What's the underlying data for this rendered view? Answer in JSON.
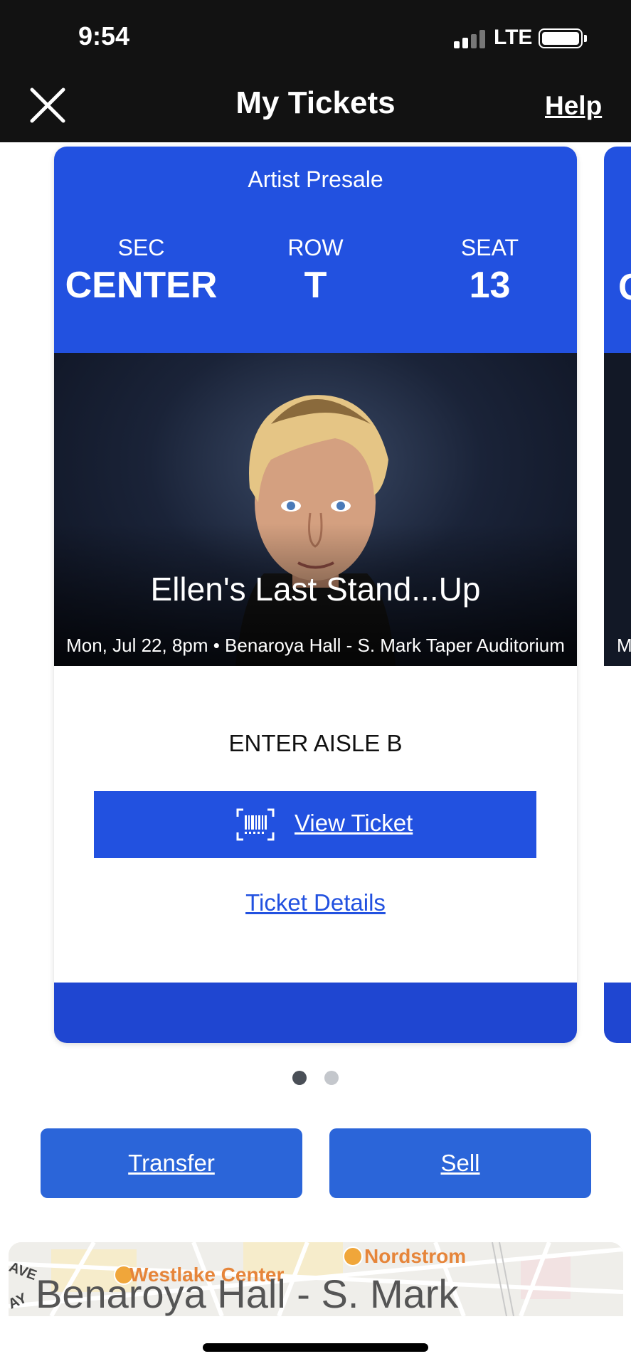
{
  "status_bar": {
    "time": "9:54",
    "network": "LTE"
  },
  "header": {
    "title": "My Tickets",
    "help_label": "Help"
  },
  "ticket": {
    "presale_label": "Artist Presale",
    "section": {
      "label": "SEC",
      "value": "CENTER"
    },
    "row": {
      "label": "ROW",
      "value": "T"
    },
    "seat": {
      "label": "SEAT",
      "value": "13"
    },
    "event_title": "Ellen's Last Stand...Up",
    "event_info": "Mon, Jul 22, 8pm • Benaroya Hall - S. Mark Taper Auditorium",
    "entry_info": "ENTER AISLE B",
    "view_ticket_label": "View Ticket",
    "details_label": "Ticket Details"
  },
  "next_ticket": {
    "section_initial": "C",
    "info_initial": "M"
  },
  "pager": {
    "count": 2,
    "active_index": 0
  },
  "actions": {
    "transfer_label": "Transfer",
    "sell_label": "Sell"
  },
  "map": {
    "venue_label": "Benaroya Hall - S. Mark",
    "poi_1": "Westlake Center",
    "poi_2": "Nordstrom",
    "street_1": "AVE",
    "street_2": "AY"
  },
  "colors": {
    "header_bg": "#121212",
    "ticket_blue": "#2251e0",
    "ticket_bottom_blue": "#1f46d1",
    "action_blue": "#2b65d9",
    "dot_active": "#4a4f57",
    "dot_inactive": "#c4c7cc"
  }
}
